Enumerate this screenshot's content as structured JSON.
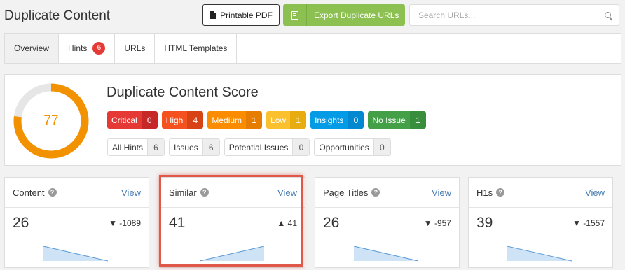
{
  "header": {
    "title": "Duplicate Content",
    "pdf_label": "Printable PDF",
    "export_label": "Export Duplicate URLs",
    "search_placeholder": "Search URLs..."
  },
  "tabs": [
    {
      "label": "Overview",
      "active": true
    },
    {
      "label": "Hints",
      "badge": "6"
    },
    {
      "label": "URLs"
    },
    {
      "label": "HTML Templates"
    }
  ],
  "score": {
    "title": "Duplicate Content Score",
    "value": "77",
    "fraction": 0.77,
    "severities": [
      {
        "label": "Critical",
        "count": "0",
        "color": "#e53935",
        "count_color": "#c62828"
      },
      {
        "label": "High",
        "count": "4",
        "color": "#f4511e",
        "count_color": "#d84315"
      },
      {
        "label": "Medium",
        "count": "1",
        "color": "#fb8c00",
        "count_color": "#e67c00"
      },
      {
        "label": "Low",
        "count": "1",
        "color": "#fbc02d",
        "count_color": "#e6ac10"
      },
      {
        "label": "Insights",
        "count": "0",
        "color": "#039be5",
        "count_color": "#0288d1"
      },
      {
        "label": "No Issue",
        "count": "1",
        "color": "#43a047",
        "count_color": "#388e3c"
      }
    ],
    "hint_types": [
      {
        "label": "All Hints",
        "count": "6"
      },
      {
        "label": "Issues",
        "count": "6"
      },
      {
        "label": "Potential Issues",
        "count": "0"
      },
      {
        "label": "Opportunities",
        "count": "0"
      }
    ]
  },
  "cards": [
    {
      "title": "Content",
      "view": "View",
      "value": "26",
      "arrow": "▼",
      "delta": "-1089",
      "trend": "down"
    },
    {
      "title": "Similar",
      "view": "View",
      "value": "41",
      "arrow": "▲",
      "delta": "41",
      "trend": "up"
    },
    {
      "title": "Page Titles",
      "view": "View",
      "value": "26",
      "arrow": "▼",
      "delta": "-957",
      "trend": "down"
    },
    {
      "title": "H1s",
      "view": "View",
      "value": "39",
      "arrow": "▼",
      "delta": "-1557",
      "trend": "down"
    }
  ],
  "colors": {
    "accent": "#f39200",
    "export_green": "#8cc152",
    "link": "#4a7eb5",
    "highlight": "#e0584a",
    "spark_fill": "#cfe3f7",
    "spark_line": "#5b9bd5"
  }
}
